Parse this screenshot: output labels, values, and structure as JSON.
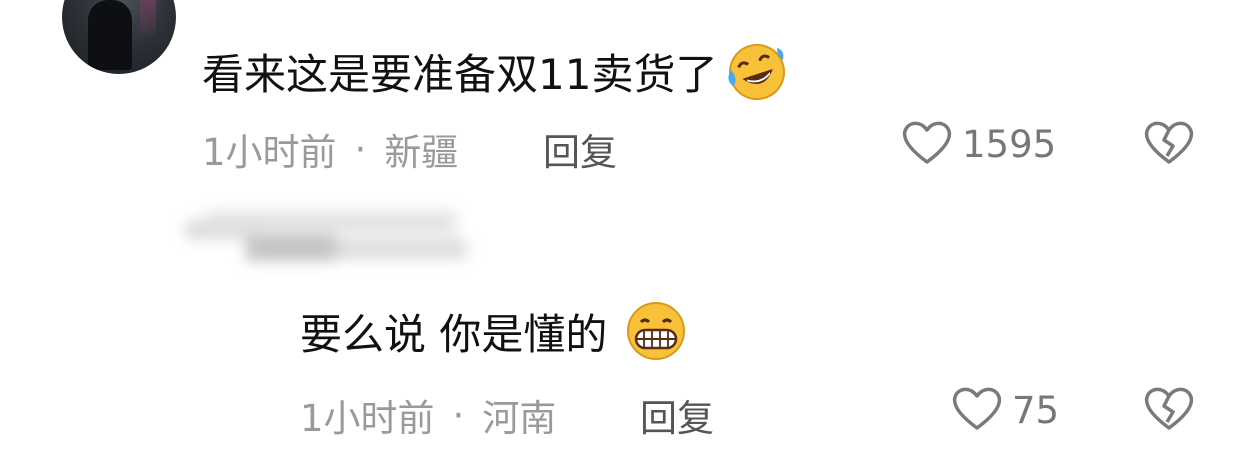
{
  "comment": {
    "text": "看来这是要准备双11卖货了",
    "emoji_icon": "rolling-on-floor-laughing-icon",
    "time": "1小时前",
    "separator": "·",
    "location": "新疆",
    "reply_label": "回复",
    "like_count": "1595"
  },
  "reply": {
    "text": "要么说 你是懂的",
    "emoji_icon": "grinning-face-icon",
    "time": "1小时前",
    "separator": "·",
    "location": "河南",
    "reply_label": "回复",
    "like_count": "75"
  },
  "colors": {
    "text": "#111111",
    "meta": "#9a9a9a",
    "icon": "#7a7a7a",
    "emoji_yellow": "#f7c23a"
  }
}
